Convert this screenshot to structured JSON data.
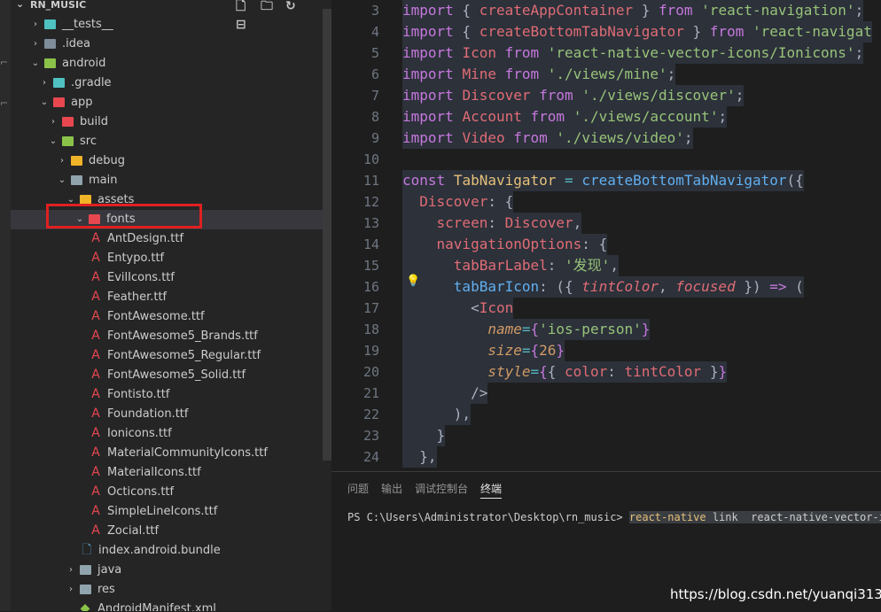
{
  "explorer": {
    "title": "RN_MUSIC",
    "actions": [
      "new-file",
      "new-folder",
      "refresh",
      "collapse"
    ],
    "items": [
      {
        "label": "__tests__",
        "depth": 1,
        "type": "folder",
        "expanded": false,
        "color": "#4fc1c1"
      },
      {
        "label": ".idea",
        "depth": 1,
        "type": "folder",
        "expanded": false,
        "color": "#7f8c9a"
      },
      {
        "label": "android",
        "depth": 1,
        "type": "folder",
        "expanded": true,
        "color": "#8bc34a"
      },
      {
        "label": ".gradle",
        "depth": 2,
        "type": "folder",
        "expanded": false,
        "color": "#4fc1c1"
      },
      {
        "label": "app",
        "depth": 2,
        "type": "folder",
        "expanded": true,
        "color": "#e8474f"
      },
      {
        "label": "build",
        "depth": 3,
        "type": "folder",
        "expanded": false,
        "color": "#e8474f"
      },
      {
        "label": "src",
        "depth": 3,
        "type": "folder",
        "expanded": true,
        "color": "#8bc34a"
      },
      {
        "label": "debug",
        "depth": 4,
        "type": "folder",
        "expanded": false,
        "color": "#f0b429"
      },
      {
        "label": "main",
        "depth": 4,
        "type": "folder",
        "expanded": true,
        "color": "#90a4ae"
      },
      {
        "label": "assets",
        "depth": 5,
        "type": "folder",
        "expanded": true,
        "color": "#f0b429"
      },
      {
        "label": "fonts",
        "depth": 6,
        "type": "folder",
        "expanded": true,
        "color": "#e8474f",
        "selected": true
      },
      {
        "label": "AntDesign.ttf",
        "depth": 7,
        "type": "font"
      },
      {
        "label": "Entypo.ttf",
        "depth": 7,
        "type": "font"
      },
      {
        "label": "EvilIcons.ttf",
        "depth": 7,
        "type": "font"
      },
      {
        "label": "Feather.ttf",
        "depth": 7,
        "type": "font"
      },
      {
        "label": "FontAwesome.ttf",
        "depth": 7,
        "type": "font"
      },
      {
        "label": "FontAwesome5_Brands.ttf",
        "depth": 7,
        "type": "font"
      },
      {
        "label": "FontAwesome5_Regular.ttf",
        "depth": 7,
        "type": "font"
      },
      {
        "label": "FontAwesome5_Solid.ttf",
        "depth": 7,
        "type": "font"
      },
      {
        "label": "Fontisto.ttf",
        "depth": 7,
        "type": "font"
      },
      {
        "label": "Foundation.ttf",
        "depth": 7,
        "type": "font"
      },
      {
        "label": "Ionicons.ttf",
        "depth": 7,
        "type": "font"
      },
      {
        "label": "MaterialCommunityIcons.ttf",
        "depth": 7,
        "type": "font"
      },
      {
        "label": "MaterialIcons.ttf",
        "depth": 7,
        "type": "font"
      },
      {
        "label": "Octicons.ttf",
        "depth": 7,
        "type": "font"
      },
      {
        "label": "SimpleLineIcons.ttf",
        "depth": 7,
        "type": "font"
      },
      {
        "label": "Zocial.ttf",
        "depth": 7,
        "type": "font"
      },
      {
        "label": "index.android.bundle",
        "depth": 6,
        "type": "file"
      },
      {
        "label": "java",
        "depth": 5,
        "type": "folder",
        "expanded": false,
        "color": "#90a4ae"
      },
      {
        "label": "res",
        "depth": 5,
        "type": "folder",
        "expanded": false,
        "color": "#90a4ae"
      },
      {
        "label": "AndroidManifest.xml",
        "depth": 5,
        "type": "android"
      }
    ]
  },
  "editor": {
    "lines": [
      {
        "n": "3",
        "t": [
          [
            "kw",
            "import"
          ],
          [
            "pl",
            " { "
          ],
          [
            "id",
            "createAppContainer"
          ],
          [
            "pl",
            " } "
          ],
          [
            "kw",
            "from"
          ],
          [
            "pl",
            " "
          ],
          [
            "st",
            "'react-navigation'"
          ],
          [
            "pl",
            ";"
          ]
        ]
      },
      {
        "n": "4",
        "t": [
          [
            "kw",
            "import"
          ],
          [
            "pl",
            " { "
          ],
          [
            "id",
            "createBottomTabNavigator"
          ],
          [
            "pl",
            " } "
          ],
          [
            "kw",
            "from"
          ],
          [
            "pl",
            " "
          ],
          [
            "st",
            "'react-navigat"
          ]
        ]
      },
      {
        "n": "5",
        "t": [
          [
            "kw",
            "import"
          ],
          [
            "pl",
            " "
          ],
          [
            "id",
            "Icon"
          ],
          [
            "pl",
            " "
          ],
          [
            "kw",
            "from"
          ],
          [
            "pl",
            " "
          ],
          [
            "st",
            "'react-native-vector-icons/Ionicons'"
          ],
          [
            "pl",
            ";"
          ]
        ]
      },
      {
        "n": "6",
        "t": [
          [
            "kw",
            "import"
          ],
          [
            "pl",
            " "
          ],
          [
            "id",
            "Mine"
          ],
          [
            "pl",
            " "
          ],
          [
            "kw",
            "from"
          ],
          [
            "pl",
            " "
          ],
          [
            "st",
            "'./views/mine'"
          ],
          [
            "pl",
            ";"
          ]
        ]
      },
      {
        "n": "7",
        "t": [
          [
            "kw",
            "import"
          ],
          [
            "pl",
            " "
          ],
          [
            "id",
            "Discover"
          ],
          [
            "pl",
            " "
          ],
          [
            "kw",
            "from"
          ],
          [
            "pl",
            " "
          ],
          [
            "st",
            "'./views/discover'"
          ],
          [
            "pl",
            ";"
          ]
        ]
      },
      {
        "n": "8",
        "t": [
          [
            "kw",
            "import"
          ],
          [
            "pl",
            " "
          ],
          [
            "id",
            "Account"
          ],
          [
            "pl",
            " "
          ],
          [
            "kw",
            "from"
          ],
          [
            "pl",
            " "
          ],
          [
            "st",
            "'./views/account'"
          ],
          [
            "pl",
            ";"
          ]
        ]
      },
      {
        "n": "9",
        "t": [
          [
            "kw",
            "import"
          ],
          [
            "pl",
            " "
          ],
          [
            "id",
            "Video"
          ],
          [
            "pl",
            " "
          ],
          [
            "kw",
            "from"
          ],
          [
            "pl",
            " "
          ],
          [
            "st",
            "'./views/video'"
          ],
          [
            "pl",
            ";"
          ]
        ]
      },
      {
        "n": "10",
        "t": []
      },
      {
        "n": "11",
        "t": [
          [
            "kw",
            "const"
          ],
          [
            "pl",
            " "
          ],
          [
            "tg",
            "TabNavigator"
          ],
          [
            "pl",
            " "
          ],
          [
            "op",
            "="
          ],
          [
            "pl",
            " "
          ],
          [
            "fn",
            "createBottomTabNavigator"
          ],
          [
            "pl",
            "({"
          ]
        ]
      },
      {
        "n": "12",
        "t": [
          [
            "pl",
            "  "
          ],
          [
            "id",
            "Discover"
          ],
          [
            "pl",
            ": {"
          ]
        ]
      },
      {
        "n": "13",
        "t": [
          [
            "pl",
            "    "
          ],
          [
            "id",
            "screen"
          ],
          [
            "pl",
            ": "
          ],
          [
            "id",
            "Discover"
          ],
          [
            "pl",
            ","
          ]
        ]
      },
      {
        "n": "14",
        "t": [
          [
            "pl",
            "    "
          ],
          [
            "id",
            "navigationOptions"
          ],
          [
            "pl",
            ": {"
          ]
        ]
      },
      {
        "n": "15",
        "t": [
          [
            "pl",
            "      "
          ],
          [
            "id",
            "tabBarLabel"
          ],
          [
            "pl",
            ": "
          ],
          [
            "st",
            "'发现'"
          ],
          [
            "pl",
            ","
          ]
        ]
      },
      {
        "n": "16",
        "t": [
          [
            "pl",
            "      "
          ],
          [
            "fn",
            "tabBarIcon"
          ],
          [
            "pl",
            ": ({ "
          ],
          [
            "pm",
            "tintColor"
          ],
          [
            "pl",
            ", "
          ],
          [
            "pm",
            "focused"
          ],
          [
            "pl",
            " }) "
          ],
          [
            "kw",
            "=>"
          ],
          [
            "pl",
            " ("
          ]
        ]
      },
      {
        "n": "17",
        "t": [
          [
            "pl",
            "        <"
          ],
          [
            "id",
            "Icon"
          ]
        ]
      },
      {
        "n": "18",
        "t": [
          [
            "pl",
            "          "
          ],
          [
            "at",
            "name"
          ],
          [
            "op",
            "="
          ],
          [
            "kw",
            "{"
          ],
          [
            "st",
            "'ios-person'"
          ],
          [
            "kw",
            "}"
          ]
        ]
      },
      {
        "n": "19",
        "t": [
          [
            "pl",
            "          "
          ],
          [
            "at",
            "size"
          ],
          [
            "op",
            "="
          ],
          [
            "kw",
            "{"
          ],
          [
            "nm",
            "26"
          ],
          [
            "kw",
            "}"
          ]
        ]
      },
      {
        "n": "20",
        "t": [
          [
            "pl",
            "          "
          ],
          [
            "at",
            "style"
          ],
          [
            "op",
            "="
          ],
          [
            "kw",
            "{"
          ],
          [
            "pl",
            "{ "
          ],
          [
            "id",
            "color"
          ],
          [
            "pl",
            ": "
          ],
          [
            "id",
            "tintColor"
          ],
          [
            "pl",
            " }"
          ],
          [
            "kw",
            "}"
          ]
        ]
      },
      {
        "n": "21",
        "t": [
          [
            "pl",
            "        />"
          ]
        ]
      },
      {
        "n": "22",
        "t": [
          [
            "pl",
            "      ),"
          ]
        ]
      },
      {
        "n": "23",
        "t": [
          [
            "pl",
            "    }"
          ]
        ]
      },
      {
        "n": "24",
        "t": [
          [
            "pl",
            "  },"
          ]
        ]
      }
    ]
  },
  "panel": {
    "tabs": [
      "问题",
      "输出",
      "调试控制台",
      "终端"
    ],
    "active_tab": 3,
    "prompt": "PS C:\\Users\\Administrator\\Desktop\\rn_music> ",
    "command": "react-native",
    "args": " link  react-native-vector-ico"
  },
  "watermark": "https://blog.csdn.net/yuanqi3131"
}
